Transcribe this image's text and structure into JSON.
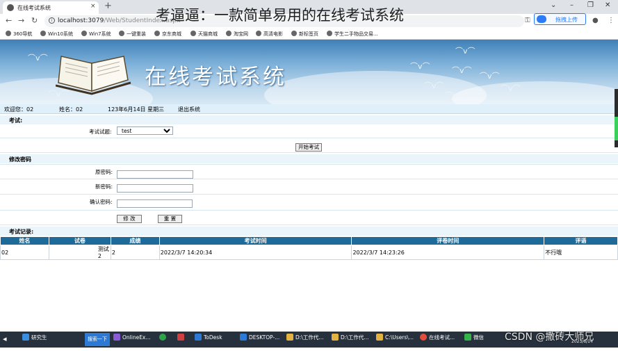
{
  "browser": {
    "tab_title": "在线考试系统",
    "tab_close": "×",
    "new_tab": "+",
    "url_host": "localhost:3079",
    "url_path": "/Web/StudentIndex.aspx",
    "upload_label": "拖拽上传",
    "win_min": "⌄",
    "win_min2": "–",
    "win_restore": "❐",
    "win_close": "✕",
    "bookmarks": [
      "360导航",
      "Win10系统",
      "Win7系统",
      "一键重装",
      "京东商城",
      "天猫商城",
      "淘宝网",
      "高清电影",
      "新标签页",
      "学生二手物品交易..."
    ]
  },
  "caption": "考逼逼：一款简单易用的在线考试系统",
  "banner": {
    "title": "在线考试系统"
  },
  "info_bar": {
    "welcome": "欢迎您：02",
    "name": "姓名：02",
    "date": "123年6月14日 星期三",
    "logout": "退出系统"
  },
  "exam": {
    "header": "考试:",
    "select_label": "考试试题:",
    "selected": "test",
    "start_button": "开始考试"
  },
  "password": {
    "header": "修改密码",
    "old_label": "原密码:",
    "new_label": "新密码:",
    "confirm_label": "确认密码:",
    "modify_button": "修 改",
    "reset_button": "重 置"
  },
  "records": {
    "header": "考试记录:",
    "columns": [
      "姓名",
      "试卷",
      "成绩",
      "考试时间",
      "评卷时间",
      "评语"
    ],
    "rows": [
      [
        "02",
        "测试2",
        "2",
        "2022/3/7 14:20:34",
        "2022/3/7 14:23:26",
        "不行哦"
      ]
    ]
  },
  "taskbar": {
    "start": "研究生",
    "search": "搜索一下",
    "items": [
      "OnlineEx...",
      "ToDesk",
      "DESKTOP-...",
      "D:\\工作代...",
      "D:\\工作代...",
      "C:\\Users\\...",
      "在线考试...",
      "微信"
    ],
    "clock": "2023/6/14"
  },
  "watermark": "CSDN @撒砖大师兄",
  "colors": {
    "table_header": "#1e6b9a",
    "info_bar": "#dff0fb",
    "taskbar": "#27313d"
  }
}
